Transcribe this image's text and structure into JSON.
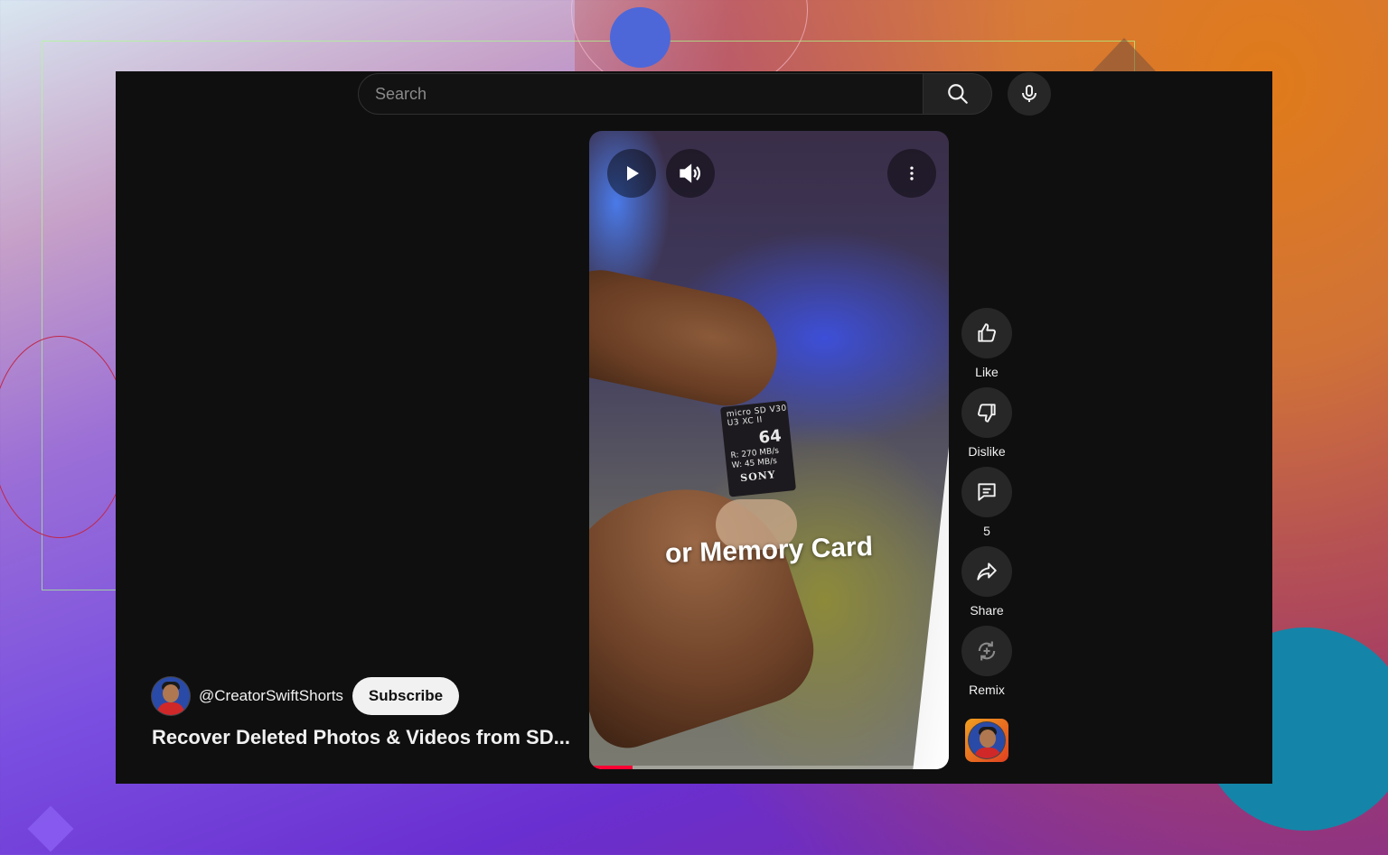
{
  "search": {
    "placeholder": "Search"
  },
  "video": {
    "caption": "or Memory Card",
    "progress_fraction": 0.12,
    "card": {
      "top_text": "micro SD V30 U3 XC II",
      "capacity": "64",
      "read": "R: 270 MB/s",
      "write": "W: 45 MB/s",
      "brand": "SONY"
    }
  },
  "actions": {
    "like_label": "Like",
    "dislike_label": "Dislike",
    "comments_count": "5",
    "share_label": "Share",
    "remix_label": "Remix"
  },
  "channel": {
    "handle": "@CreatorSwiftShorts",
    "subscribe_label": "Subscribe"
  },
  "short": {
    "title": "Recover Deleted Photos & Videos from SD..."
  },
  "icons": [
    "search-icon",
    "mic-icon",
    "play-icon",
    "volume-icon",
    "more-vert-icon",
    "thumbs-up-icon",
    "thumbs-down-icon",
    "comment-icon",
    "share-icon",
    "remix-icon"
  ]
}
